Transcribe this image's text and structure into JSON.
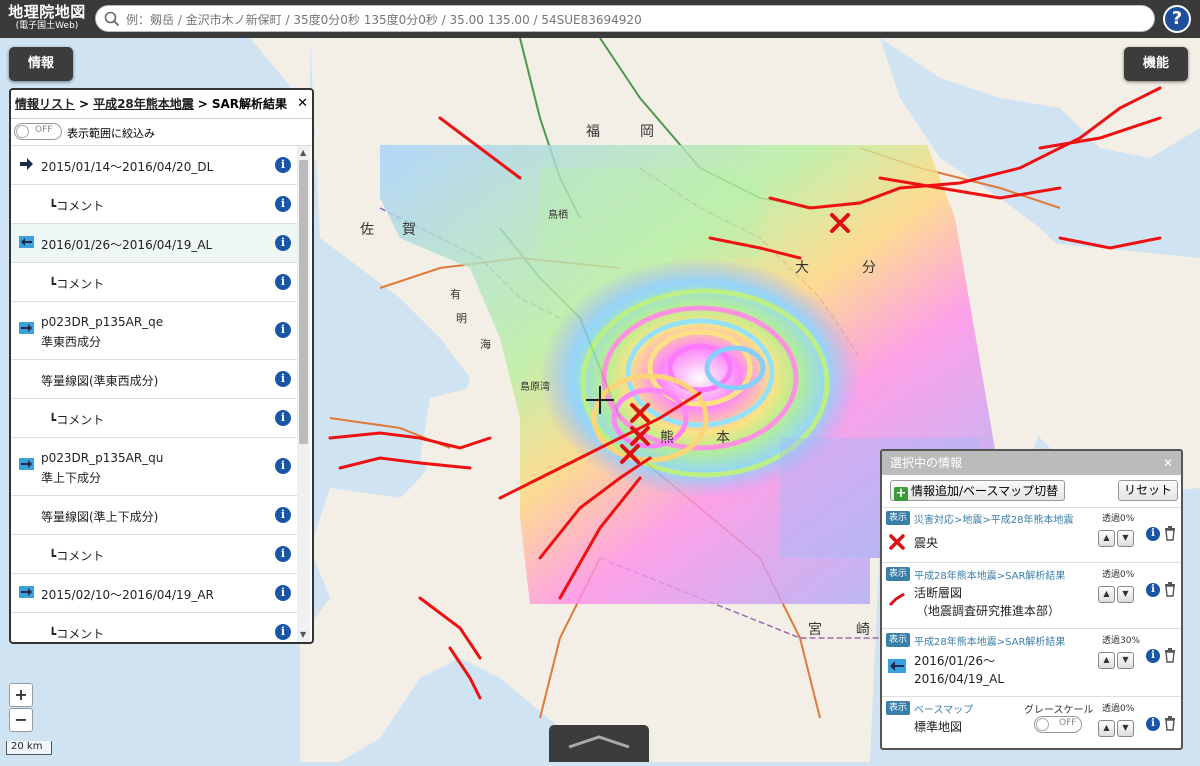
{
  "header": {
    "logo_line1": "地理院地図",
    "logo_line2": "(電子国土Web)",
    "search_placeholder": "例：剱岳 / 金沢市木ノ新保町 / 35度0分0秒 135度0分0秒 / 35.00 135.00 / 54SUE83694920",
    "help_label": "?"
  },
  "buttons": {
    "info": "情報",
    "functions": "機能",
    "zoom_in": "+",
    "zoom_out": "−"
  },
  "scale_label": "20 km",
  "map": {
    "place_labels": [
      "福",
      "岡",
      "佐",
      "賀",
      "熊",
      "本",
      "宮",
      "崎",
      "分",
      "大",
      "有",
      "明",
      "海",
      "鳥栖",
      "島原湾"
    ],
    "sar_palette": [
      "#ff60ff",
      "#ff8ad8",
      "#ffe070",
      "#b8f070",
      "#70e0c8",
      "#70c8ff",
      "#a0a0ff",
      "#e080ff"
    ]
  },
  "info_panel": {
    "breadcrumb": [
      "情報リスト",
      "平成28年熊本地震",
      "SAR解析結果"
    ],
    "breadcrumb_sep": ">",
    "close": "✕",
    "filter_toggle": "OFF",
    "filter_label": "表示範囲に絞込み",
    "items": [
      {
        "label": "2015/01/14〜2016/04/20_DL",
        "arrow": "right-dark"
      },
      {
        "label": "┗コメント",
        "arrow": ""
      },
      {
        "label": "2016/01/26〜2016/04/19_AL",
        "arrow": "left-blue"
      },
      {
        "label": "┗コメント",
        "arrow": ""
      },
      {
        "label": "p023DR_p135AR_qe",
        "label2": "準東西成分",
        "arrow": "right-blue"
      },
      {
        "label": "等量線図(準東西成分)",
        "arrow": ""
      },
      {
        "label": "┗コメント",
        "arrow": ""
      },
      {
        "label": "p023DR_p135AR_qu",
        "label2": "準上下成分",
        "arrow": "right-blue"
      },
      {
        "label": "等量線図(準上下成分)",
        "arrow": ""
      },
      {
        "label": "┗コメント",
        "arrow": ""
      },
      {
        "label": "2015/02/10〜2016/04/19_AR",
        "arrow": "right-blue"
      },
      {
        "label": "┗コメント",
        "arrow": ""
      }
    ]
  },
  "selected_panel": {
    "title": "選択中の情報",
    "close": "✕",
    "add_button": "情報追加/ベースマップ切替",
    "reset_button": "リセット",
    "layers": [
      {
        "badge": "表示",
        "path": "災害対応>地震>平成28年熊本地震",
        "title": "震央",
        "opacity": "透過0%",
        "icon": "epicenter-x"
      },
      {
        "badge": "表示",
        "path": "平成28年熊本地震>SAR解析結果",
        "title": "活断層図",
        "title2": "（地震調査研究推進本部）",
        "opacity": "透過0%",
        "icon": "fault-line"
      },
      {
        "badge": "表示",
        "path": "平成28年熊本地震>SAR解析結果",
        "title": "2016/01/26〜",
        "title2": "2016/04/19_AL",
        "opacity": "透過30%",
        "icon": "left-arrow"
      },
      {
        "badge": "表示",
        "path": "ベースマップ",
        "title": "標準地図",
        "opacity": "透過0%",
        "grayscale_label": "グレースケール",
        "grayscale_toggle": "OFF"
      }
    ]
  }
}
